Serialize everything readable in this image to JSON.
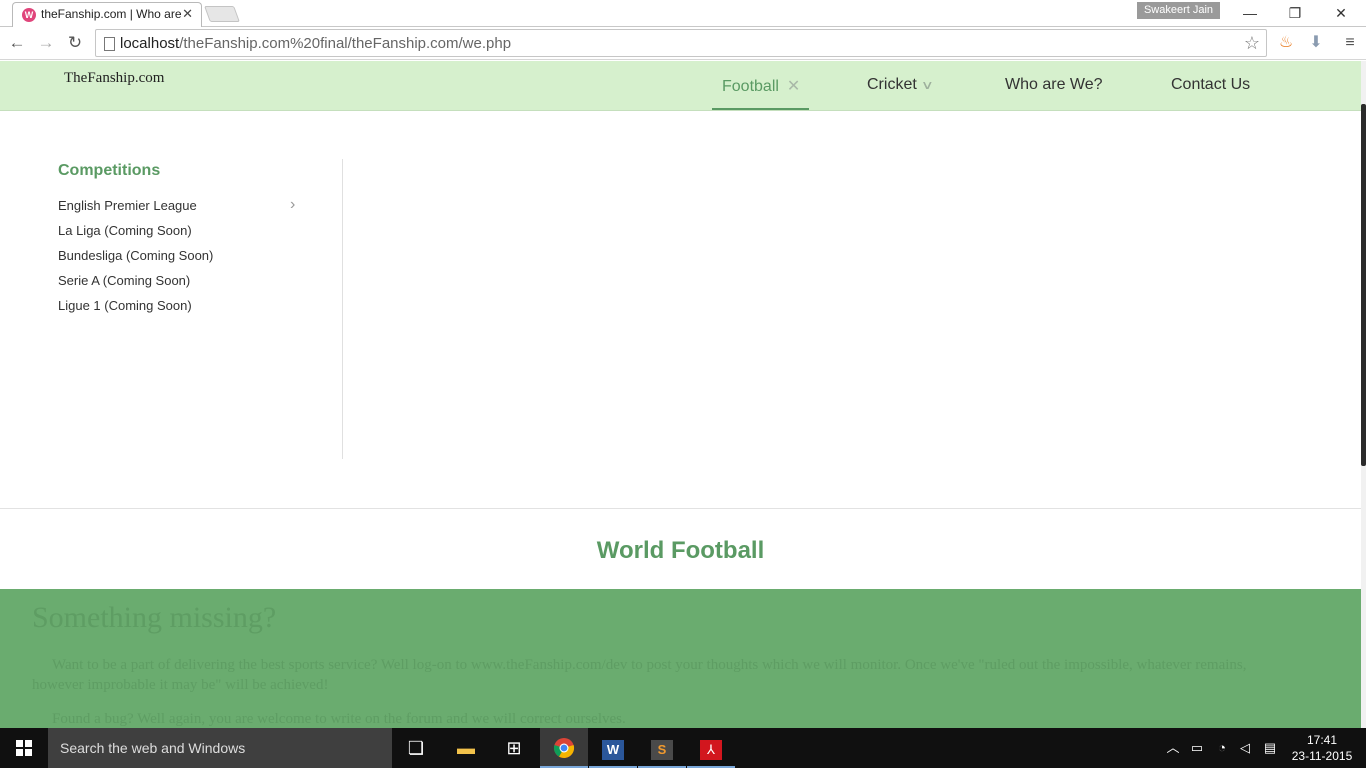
{
  "browser": {
    "tab_title": "theFanship.com | Who are",
    "tab_favicon_letter": "W",
    "profile_name": "Swakeert Jain",
    "url_host": "localhost",
    "url_path": "/theFanship.com%20final/theFanship.com/we.php",
    "icons": {
      "back": "back-arrow-icon",
      "forward": "forward-arrow-icon",
      "reload": "reload-icon",
      "star": "bookmark-star-icon",
      "menu": "hamburger-menu-icon"
    }
  },
  "site": {
    "logo": "TheFanship.com",
    "nav": [
      {
        "label": "Football",
        "suffix": "✕",
        "active": true
      },
      {
        "label": "Cricket",
        "suffix": "∨",
        "active": false
      },
      {
        "label": "Who are We?",
        "suffix": "",
        "active": false
      },
      {
        "label": "Contact Us",
        "suffix": "",
        "active": false
      }
    ],
    "mega": {
      "competitions_title": "Competitions",
      "competitions": [
        "English Premier League",
        "La Liga (Coming Soon)",
        "Bundesliga (Coming Soon)",
        "Serie A (Coming Soon)",
        "Ligue 1 (Coming Soon)"
      ]
    },
    "world_title": "World Football",
    "missing": {
      "title": "Something missing?",
      "p1": "Want to be a part of delivering the best sports service? Well log-on to www.theFanship.com/dev to post your thoughts which we will monitor. Once we've \"ruled out the impossible, whatever remains, however improbable it may be\" will be achieved!",
      "p2": "Found a bug? Well again, you are welcome to write on the forum and we will correct ourselves."
    },
    "colors": {
      "accent": "#5a9a63",
      "header_bg": "#d6f0cd",
      "footer_bg": "#6aac6f"
    }
  },
  "taskbar": {
    "search_placeholder": "Search the web and Windows",
    "time": "17:41",
    "date": "23-11-2015"
  }
}
